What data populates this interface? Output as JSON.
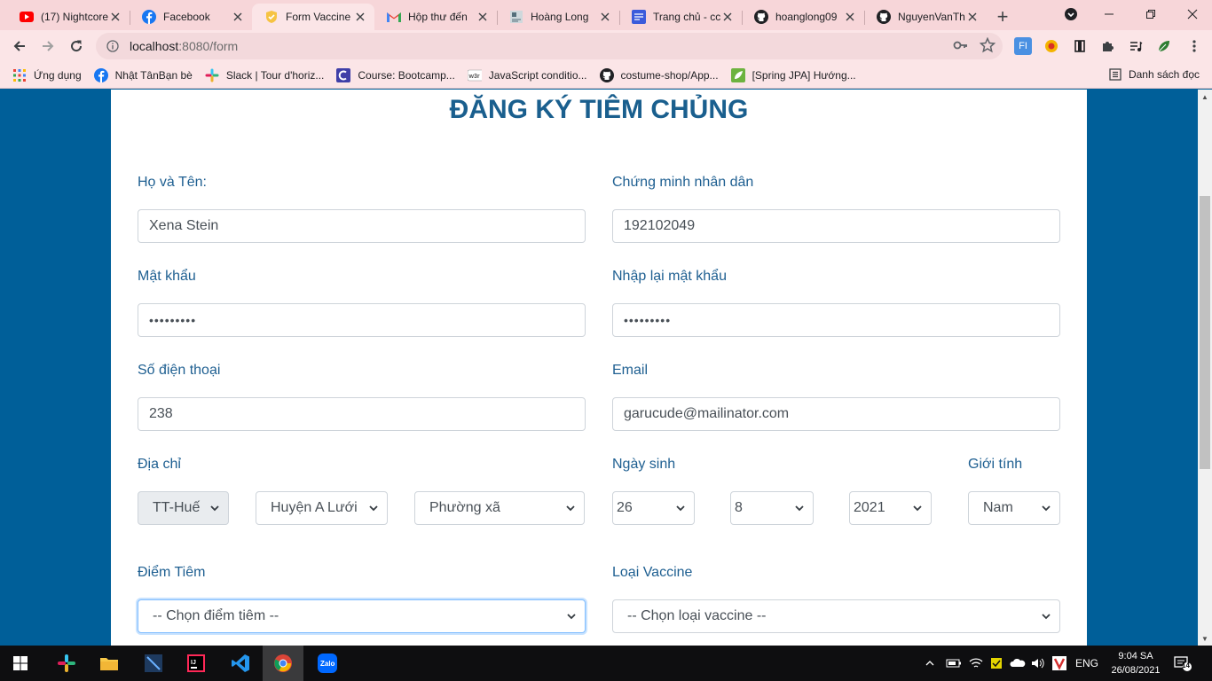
{
  "browser": {
    "tabs": [
      {
        "title": "(17) Nightcore",
        "icon": "youtube-icon",
        "color": "#ff0000"
      },
      {
        "title": "Facebook",
        "icon": "facebook-icon",
        "color": "#1877f2"
      },
      {
        "title": "Form Vaccine",
        "icon": "shield-icon",
        "color": "#e8a317",
        "active": true
      },
      {
        "title": "Hộp thư đến",
        "icon": "gmail-icon",
        "color": "#ea4335"
      },
      {
        "title": "Hoàng Long",
        "icon": "page-icon",
        "color": "#5f6368"
      },
      {
        "title": "Trang chủ - cc",
        "icon": "site-icon",
        "color": "#3b5bdb"
      },
      {
        "title": "hoanglong09",
        "icon": "github-icon",
        "color": "#202124"
      },
      {
        "title": "NguyenVanTh",
        "icon": "github-icon",
        "color": "#202124"
      }
    ],
    "url_host": "localhost",
    "url_path": ":8080/form",
    "bookmarks": [
      {
        "label": "Ứng dụng",
        "icon": "apps-grid-icon"
      },
      {
        "label": "Nhật TânBạn bè",
        "icon": "facebook-icon"
      },
      {
        "label": "Slack | Tour d'horiz...",
        "icon": "slack-icon"
      },
      {
        "label": "Course: Bootcamp...",
        "icon": "course-icon"
      },
      {
        "label": "JavaScript conditio...",
        "icon": "w3r-icon"
      },
      {
        "label": "costume-shop/App...",
        "icon": "github-icon"
      },
      {
        "label": "[Spring JPA] Hướng...",
        "icon": "spring-icon"
      }
    ],
    "reading_list": "Danh sách đọc"
  },
  "form": {
    "title": "ĐĂNG KÝ TIÊM CHỦNG",
    "full_name": {
      "label": "Họ và Tên:",
      "value": "Xena Stein"
    },
    "id_card": {
      "label": "Chứng minh nhân dân",
      "value": "192102049"
    },
    "password": {
      "label": "Mật khẩu",
      "value": "•••••••••"
    },
    "password_confirm": {
      "label": "Nhập lại mật khẩu",
      "value": "•••••••••"
    },
    "phone": {
      "label": "Số điện thoại",
      "value": "238"
    },
    "email": {
      "label": "Email",
      "value": "garucude@mailinator.com"
    },
    "address": {
      "label": "Địa chỉ",
      "province": "TT-Huế",
      "district": "Huyện A Lưới",
      "ward": "Phường xã"
    },
    "birthday": {
      "label": "Ngày sinh",
      "day": "26",
      "month": "8",
      "year": "2021"
    },
    "gender": {
      "label": "Giới tính",
      "value": "Nam"
    },
    "site": {
      "label": "Điểm Tiêm",
      "value": "-- Chọn điểm tiêm --"
    },
    "vaccine": {
      "label": "Loại Vaccine",
      "value": "-- Chọn loại vaccine --"
    }
  },
  "taskbar": {
    "language": "ENG",
    "time": "9:04 SA",
    "date": "26/08/2021",
    "notification_count": "14"
  },
  "colors": {
    "page_background": "#005f99",
    "label_color": "#1e5f91",
    "title_color": "#1a5f8e",
    "browser_chrome": "#fbe5e7"
  }
}
